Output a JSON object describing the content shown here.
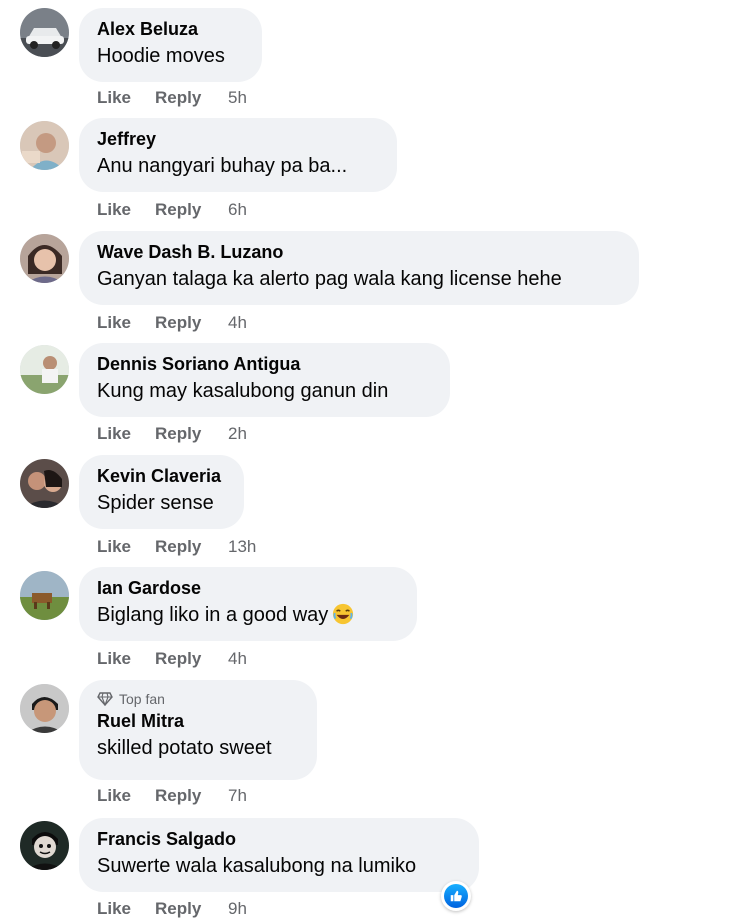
{
  "action_labels": {
    "like": "Like",
    "reply": "Reply"
  },
  "comments": [
    {
      "name": "Alex Beluza",
      "text": "Hoodie moves",
      "time": "5h",
      "avatar": "car-avatar"
    },
    {
      "name": "Jeffrey",
      "text": "Anu nangyari buhay pa ba...",
      "time": "6h",
      "avatar": "person-avatar"
    },
    {
      "name": "Wave Dash B. Luzano",
      "text": "Ganyan talaga ka alerto pag wala kang license hehe",
      "time": "4h",
      "avatar": "person-avatar"
    },
    {
      "name": "Dennis Soriano Antigua",
      "text": "Kung may kasalubong ganun din",
      "time": "2h",
      "avatar": "outdoor-avatar"
    },
    {
      "name": "Kevin Claveria",
      "text": "Spider sense",
      "time": "13h",
      "avatar": "couple-avatar"
    },
    {
      "name": "Ian Gardose",
      "text": "Biglang liko in a good way",
      "time": "4h",
      "avatar": "landscape-avatar",
      "emoji": "laughing-emoji"
    },
    {
      "name": "Ruel Mitra",
      "text": "skilled potato sweet",
      "time": "7h",
      "avatar": "person-avatar",
      "badge": "Top fan"
    },
    {
      "name": "Francis Salgado",
      "text": "Suwerte wala kasalubong na lumiko",
      "time": "9h",
      "avatar": "person-avatar",
      "reaction": "like-reaction-icon"
    }
  ],
  "colors": {
    "bubble": "#f0f2f5",
    "meta": "#65676b",
    "text": "#050505",
    "like_blue": "#0866ff"
  }
}
